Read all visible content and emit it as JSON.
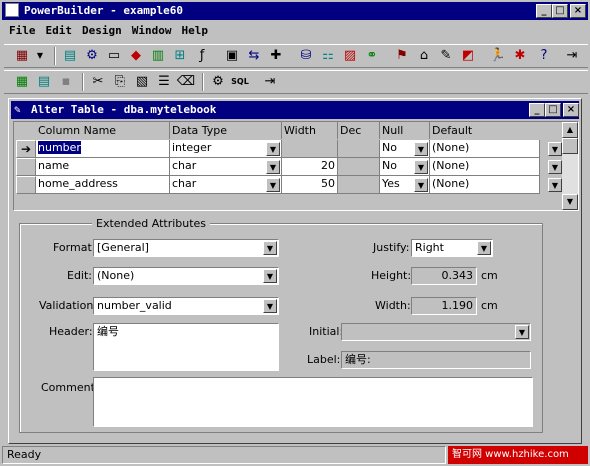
{
  "app": {
    "title": "PowerBuilder - example60",
    "min_label": "_",
    "max_label": "□",
    "close_label": "×"
  },
  "menu": [
    "File",
    "Edit",
    "Design",
    "Window",
    "Help"
  ],
  "child": {
    "title": "Alter Table - dba.mytelebook"
  },
  "grid": {
    "headers": [
      "Column Name",
      "Data Type",
      "Width",
      "Dec",
      "Null",
      "Default"
    ],
    "rows": [
      {
        "indicator": "➔",
        "name": "number",
        "type": "integer",
        "width": "",
        "dec": "",
        "null": "No",
        "default": "(None)"
      },
      {
        "indicator": "",
        "name": "name",
        "type": "char",
        "width": "20",
        "dec": "",
        "null": "No",
        "default": "(None)"
      },
      {
        "indicator": "",
        "name": "home_address",
        "type": "char",
        "width": "50",
        "dec": "",
        "null": "Yes",
        "default": "(None)"
      }
    ]
  },
  "extended": {
    "group_title": "Extended Attributes",
    "format_label": "Format:",
    "format_value": "[General]",
    "edit_label": "Edit:",
    "edit_value": "(None)",
    "validation_label": "Validation:",
    "validation_value": "number_valid",
    "header_label": "Header:",
    "header_value": "编号",
    "comment_label": "Comment:",
    "comment_value": "",
    "justify_label": "Justify:",
    "justify_value": "Right",
    "height_label": "Height:",
    "height_value": "0.343",
    "height_unit": "cm",
    "width_label": "Width:",
    "width_value": "1.190",
    "width_unit": "cm",
    "initial_label": "Initial:",
    "initial_value": "",
    "label_label": "Label:",
    "label_value": "编号:"
  },
  "status": {
    "text": "Ready"
  },
  "watermark": "智可网 www.hzhike.com"
}
